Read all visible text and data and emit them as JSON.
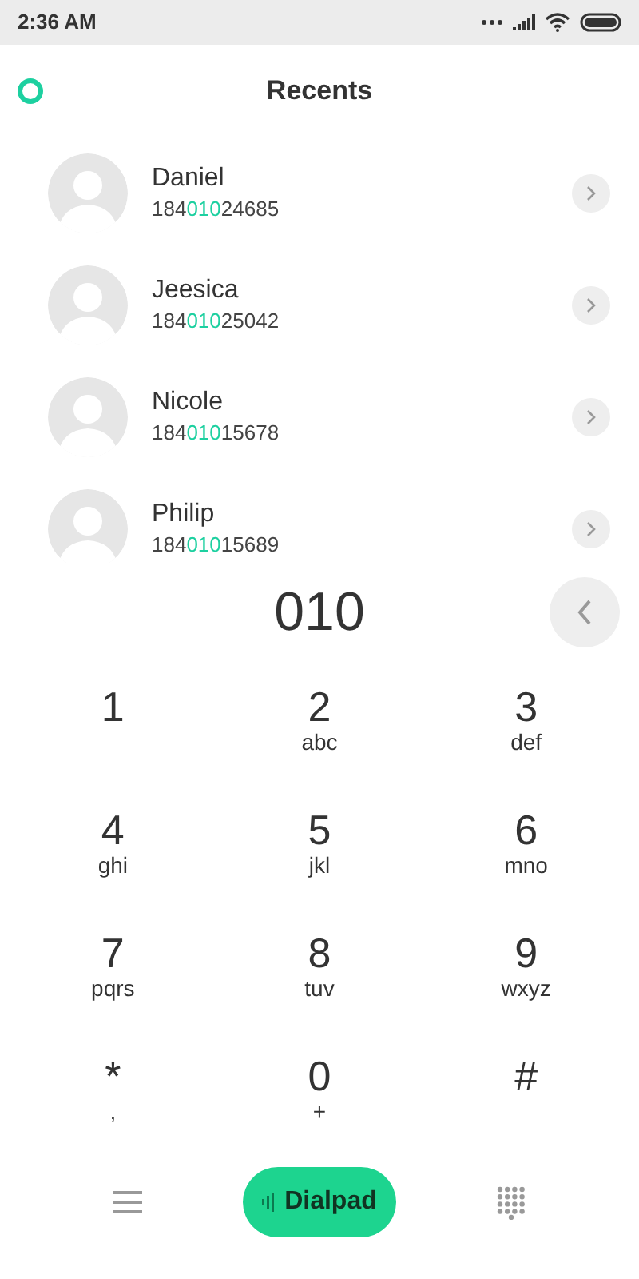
{
  "status_bar": {
    "time": "2:36 AM"
  },
  "header": {
    "title": "Recents"
  },
  "contacts": [
    {
      "name": "Daniel",
      "number": {
        "before": "184",
        "match": "010",
        "after": "24685"
      }
    },
    {
      "name": "Jeesica",
      "number": {
        "before": "184",
        "match": "010",
        "after": "25042"
      }
    },
    {
      "name": "Nicole",
      "number": {
        "before": "184",
        "match": "010",
        "after": "15678"
      }
    },
    {
      "name": "Philip",
      "number": {
        "before": "184",
        "match": "010",
        "after": "15689"
      }
    }
  ],
  "entry": {
    "value": "010"
  },
  "keys": [
    {
      "digit": "1"
    },
    {
      "digit": "2",
      "letters": "abc"
    },
    {
      "digit": "3",
      "letters": "def"
    },
    {
      "digit": "4",
      "letters": "ghi"
    },
    {
      "digit": "5",
      "letters": "jkl"
    },
    {
      "digit": "6",
      "letters": "mno"
    },
    {
      "digit": "7",
      "letters": "pqrs"
    },
    {
      "digit": "8",
      "letters": "tuv"
    },
    {
      "digit": "9",
      "letters": "wxyz"
    },
    {
      "digit": "*",
      "letters": ","
    },
    {
      "digit": "0",
      "letters": "+"
    },
    {
      "digit": "#"
    }
  ],
  "bottom_bar": {
    "dialpad_label": "Dialpad"
  }
}
